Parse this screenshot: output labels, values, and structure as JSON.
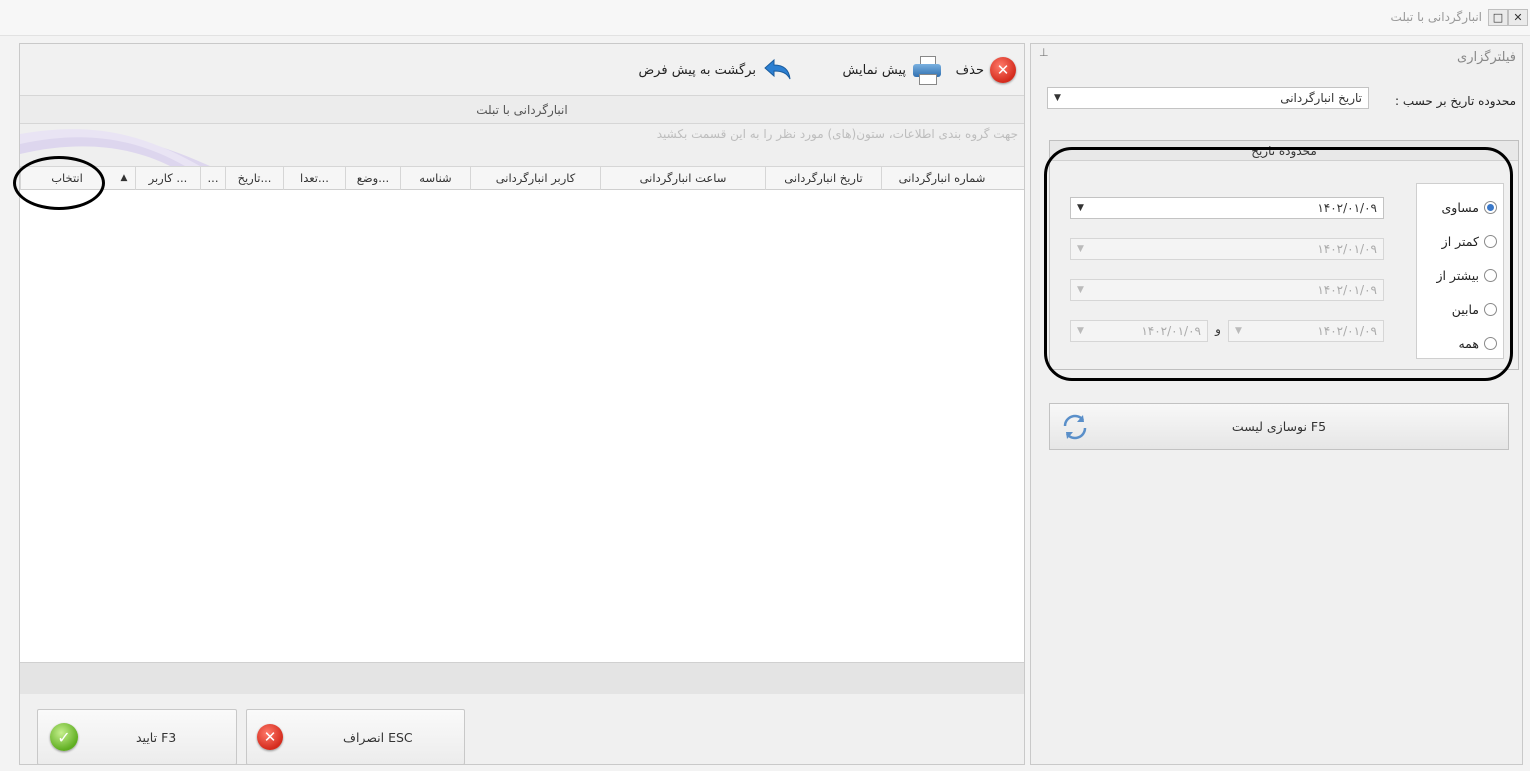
{
  "window": {
    "title": "انبارگردانی با تبلت",
    "close_glyph": "✕",
    "restore_glyph": "□"
  },
  "toolbar": {
    "delete_label": "حذف",
    "preview_label": "پیش نمایش",
    "reset_label": "برگشت به پیش فرض"
  },
  "grid": {
    "title": "انبارگردانی با تبلت",
    "group_hint": "جهت گروه بندی اطلاعات، ستون(های) مورد نظر را به این قسمت بکشید",
    "columns": [
      "شماره انبارگردانی",
      "تاریخ انبارگردانی",
      "ساعت انبارگردانی",
      "کاربر انبارگردانی",
      "شناسه",
      "وضع...",
      "تعدا...",
      "تاریخ...",
      "...",
      "کاربر ...",
      "▲",
      "انتخاب"
    ]
  },
  "buttons": {
    "confirm_label": "تایید F3",
    "cancel_label": "انصراف ESC",
    "refresh_label": "نوسازی لیست F5"
  },
  "filter": {
    "title": "فیلترگزاری",
    "pin_glyph": "⊥",
    "range_by_label": "محدوده تاریخ بر حسب :",
    "range_by_value": "تاریخ انبارگردانی",
    "date_range_title": "محدوده تاریخ",
    "options": [
      "مساوی",
      "کمتر از",
      "بیشتر از",
      "مابین",
      "همه"
    ],
    "selected_option": "مساوی",
    "date_equal": "۱۴۰۲/۰۱/۰۹",
    "date_less": "۱۴۰۲/۰۱/۰۹",
    "date_more": "۱۴۰۲/۰۱/۰۹",
    "date_between_from": "۱۴۰۲/۰۱/۰۹",
    "date_between_to": "۱۴۰۲/۰۱/۰۹",
    "between_and": "و"
  },
  "colors": {
    "accent_blue": "#3a78c9",
    "danger_red": "#d42b1d",
    "ok_green": "#5fae21"
  }
}
